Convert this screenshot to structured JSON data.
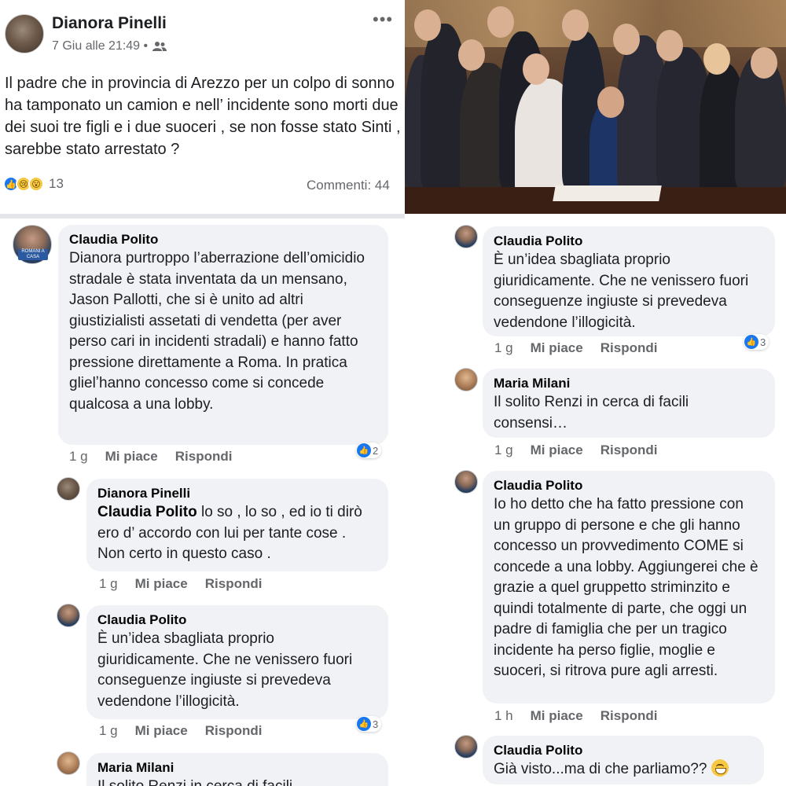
{
  "post": {
    "author": "Dianora Pinelli",
    "meta": "7 Giu alle 21:49 •",
    "more": "•••",
    "text": "Il padre che in provincia di Arezzo per un colpo di sonno ha tamponato un camion e nell’ incidente sono morti due dei suoi tre figli e i due suoceri , se non fosse stato Sinti , sarebbe stato arrestato ?",
    "reaction_count": "13",
    "comments_label": "Commenti: 44",
    "reactions": [
      "like",
      "sad",
      "wow"
    ]
  },
  "comments_left": [
    {
      "name": "Claudia Polito",
      "text": "Dianora purtroppo l’aberrazione dell’omicidio stradale è stata inventata da un mensano, Jason Pallotti, che si è unito ad altri giustizialisti assetati di vendetta (per aver perso cari in incidenti stradali) e hanno fatto pressione direttamente a Roma. In pratica glielʼhanno concesso come si concede qualcosa a una lobby.",
      "time": "1 g",
      "like": "Mi piace",
      "reply": "Rispondi",
      "reactions": "2"
    },
    {
      "name": "Dianora Pinelli",
      "mention": "Claudia Polito",
      "text": " lo so , lo so , ed io ti dirò ero d’ accordo con lui per tante cose . Non certo in questo caso .",
      "time": "1 g",
      "like": "Mi piace",
      "reply": "Rispondi"
    },
    {
      "name": "Claudia Polito",
      "text": "È un’idea sbagliata proprio giuridicamente. Che ne venissero fuori conseguenze ingiuste si prevedeva vedendone l’illogicità.",
      "time": "1 g",
      "like": "Mi piace",
      "reply": "Rispondi",
      "reactions": "3"
    },
    {
      "name": "Maria Milani",
      "text": "Il solito Renzi in cerca di facili"
    }
  ],
  "comments_right": [
    {
      "name": "Claudia Polito",
      "text": "È un’idea sbagliata proprio giuridicamente. Che ne venissero fuori conseguenze ingiuste si prevedeva vedendone l’illogicità.",
      "time": "1 g",
      "like": "Mi piace",
      "reply": "Rispondi",
      "reactions": "3"
    },
    {
      "name": "Maria Milani",
      "text": "Il solito Renzi in cerca di facili consensi…",
      "time": "1 g",
      "like": "Mi piace",
      "reply": "Rispondi"
    },
    {
      "name": "Claudia Polito",
      "text": "Io ho detto che ha fatto pressione con un gruppo di persone e che gli hanno concesso un provvedimento COME si concede a una lobby. Aggiungerei che è grazie a quel gruppetto striminzito e quindi totalmente di parte, che oggi un padre di famiglia che per un tragico incidente ha perso figlie, moglie e suoceri, si ritrova pure agli arresti.",
      "time": "1 h",
      "like": "Mi piace",
      "reply": "Rispondi"
    },
    {
      "name": "Claudia Polito",
      "text": "Già visto...ma di che parliamo?? ",
      "emoji": "grinning-sweat-emoji"
    }
  ],
  "avatar_tag": "ROMANI A CASA",
  "colors": {
    "bubble": "#f0f2f5",
    "like_blue": "#1877f2",
    "meta_gray": "#65676b"
  }
}
